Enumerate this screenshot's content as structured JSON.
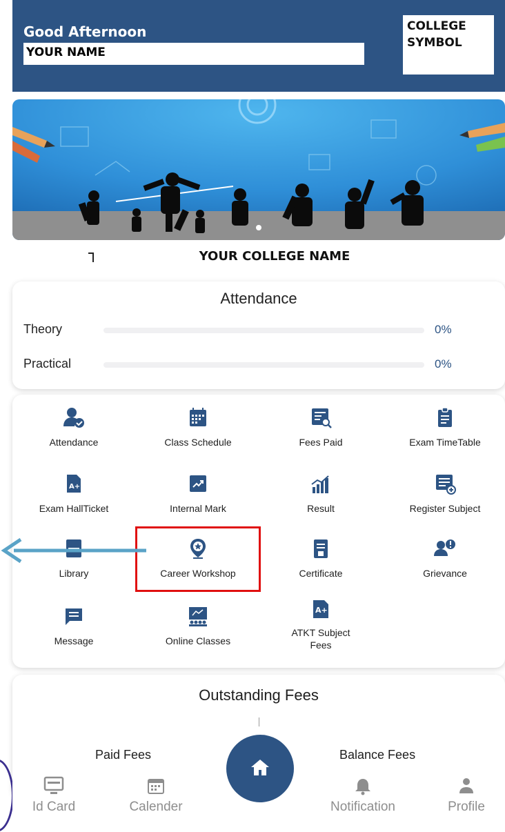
{
  "header": {
    "greeting": "Good Afternoon",
    "user_name": "YOUR NAME",
    "logo_text_line1": "COLLEGE",
    "logo_text_line2": "SYMBOL"
  },
  "college_name": "YOUR COLLEGE NAME",
  "attendance": {
    "title": "Attendance",
    "rows": [
      {
        "label": "Theory",
        "percent": "0%"
      },
      {
        "label": "Practical",
        "percent": "0%"
      }
    ]
  },
  "modules": [
    {
      "label": "Attendance",
      "icon": "user-check-icon"
    },
    {
      "label": "Class Schedule",
      "icon": "calendar-grid-icon"
    },
    {
      "label": "Fees Paid",
      "icon": "receipt-search-icon"
    },
    {
      "label": "Exam TimeTable",
      "icon": "clipboard-icon"
    },
    {
      "label": "Exam HallTicket",
      "icon": "a-plus-document-icon"
    },
    {
      "label": "Internal Mark",
      "icon": "trend-chart-icon"
    },
    {
      "label": "Result",
      "icon": "bar-chart-icon"
    },
    {
      "label": "Register Subject",
      "icon": "list-add-icon"
    },
    {
      "label": "Library",
      "icon": "book-icon"
    },
    {
      "label": "Career Workshop",
      "icon": "star-pin-icon"
    },
    {
      "label": "Certificate",
      "icon": "certificate-icon"
    },
    {
      "label": "Grievance",
      "icon": "user-alert-icon"
    },
    {
      "label": "Message",
      "icon": "chat-icon"
    },
    {
      "label": "Online Classes",
      "icon": "classroom-icon"
    },
    {
      "label": "ATKT Subject Fees",
      "icon": "a-plus-icon"
    }
  ],
  "outstanding": {
    "title": "Outstanding Fees",
    "paid_label": "Paid Fees",
    "balance_label": "Balance Fees"
  },
  "bottom_nav": [
    {
      "label": "Id Card",
      "icon": "id-card-icon"
    },
    {
      "label": "Calender",
      "icon": "calendar-icon"
    },
    {
      "label": "Notification",
      "icon": "bell-icon"
    },
    {
      "label": "Profile",
      "icon": "person-icon"
    }
  ],
  "colors": {
    "primary": "#2d5484",
    "highlight": "#e01010",
    "arrow": "#5aa3c7"
  }
}
